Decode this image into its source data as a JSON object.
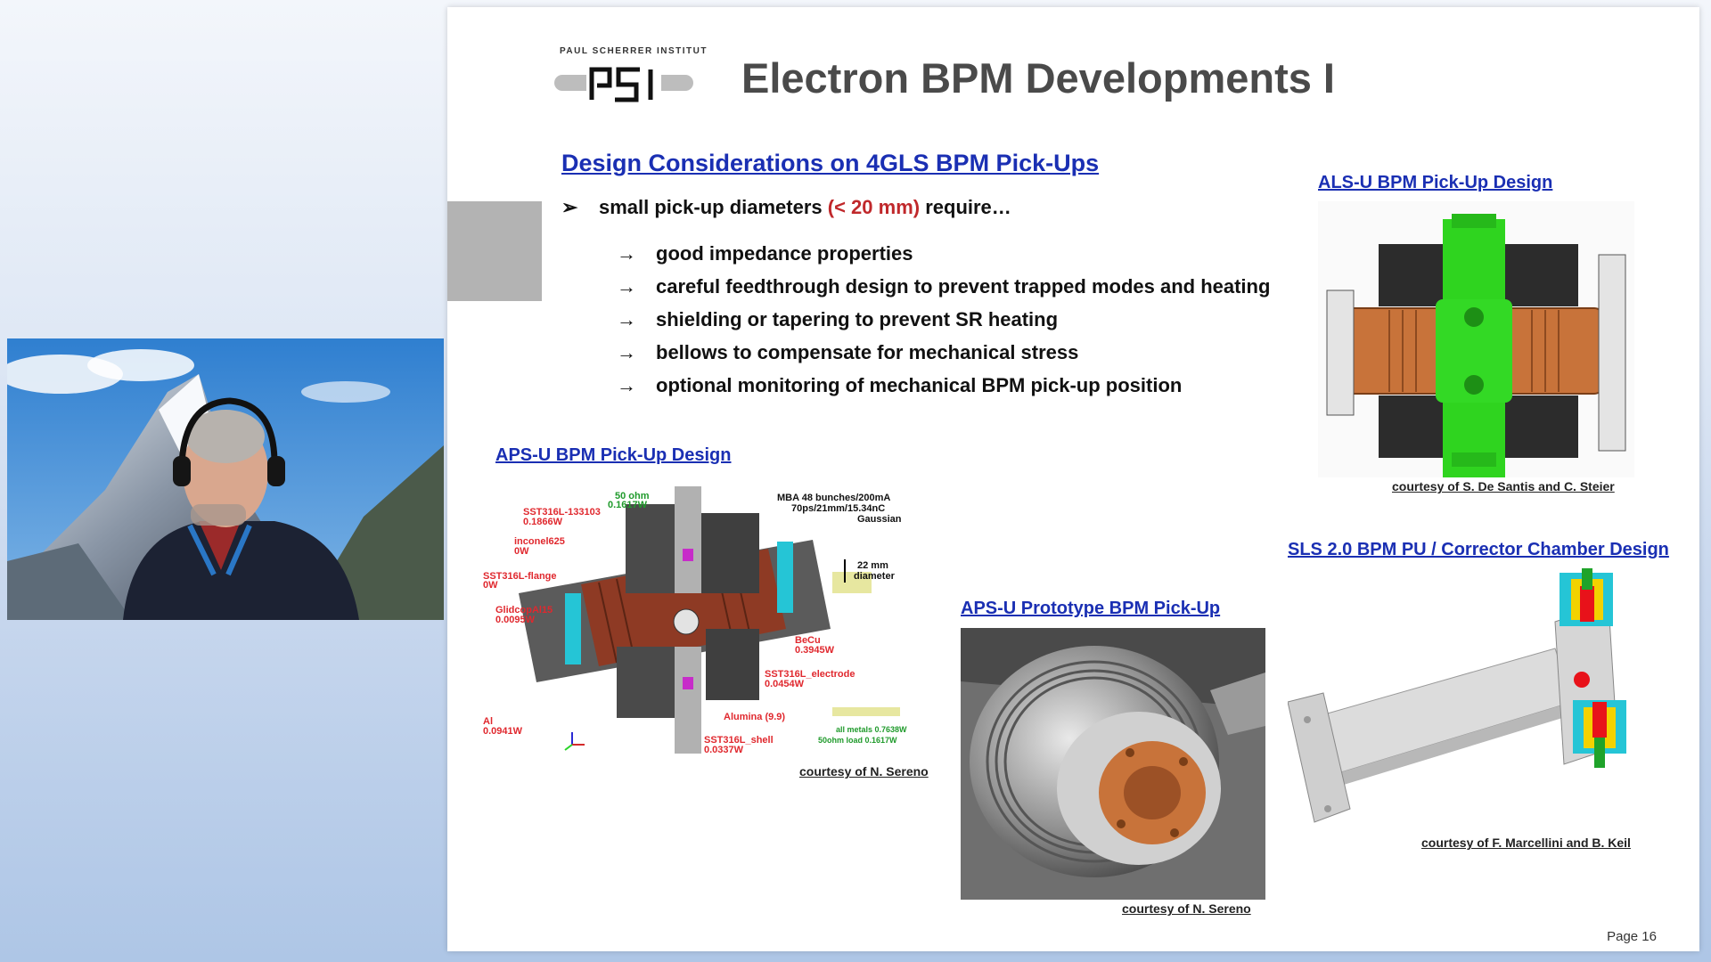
{
  "slide": {
    "logo_caption": "PAUL SCHERRER INSTITUT",
    "logo_text": "PSI",
    "title": "Electron BPM Developments I",
    "heading": "Design Considerations on 4GLS BPM Pick-Ups",
    "bullet": {
      "prefix": "small pick-up diameters ",
      "highlight": "(< 20 mm)",
      "suffix": " require…",
      "marker": "➢"
    },
    "sub_arrow": "→",
    "sub_items": [
      "good impedance properties",
      "careful feedthrough design to prevent trapped modes and heating",
      "shielding or tapering to prevent SR heating",
      "bellows to compensate for mechanical stress",
      "optional monitoring of mechanical BPM pick-up position"
    ],
    "figures": {
      "alsu": {
        "title": "ALS-U BPM Pick-Up Design",
        "credit": "courtesy of S. De Santis and C. Steier"
      },
      "apsu": {
        "title": "APS-U BPM Pick-Up Design",
        "credit": "courtesy of N. Sereno",
        "sim_note": [
          "MBA 48 bunches/200mA",
          "70ps/21mm/15.34nC",
          "Gaussian"
        ],
        "diameter_note": [
          "22 mm",
          "diameter"
        ],
        "labels": [
          {
            "name": "50 ohm",
            "value": "0.1617W",
            "color": "#1f9a2b"
          },
          {
            "name": "SST316L-133103",
            "value": "0.1866W",
            "color": "#e0282e"
          },
          {
            "name": "inconel625",
            "value": "0W",
            "color": "#e0282e"
          },
          {
            "name": "SST316L-flange",
            "value": "0W",
            "color": "#e0282e"
          },
          {
            "name": "GlidcopAl15",
            "value": "0.0095W",
            "color": "#e0282e"
          },
          {
            "name": "Al",
            "value": "0.0941W",
            "color": "#e0282e"
          },
          {
            "name": "BeCu",
            "value": "0.3945W",
            "color": "#e0282e"
          },
          {
            "name": "SST316L_electrode",
            "value": "0.0454W",
            "color": "#e0282e"
          },
          {
            "name": "Alumina (9.9)",
            "value": "",
            "color": "#e0282e"
          },
          {
            "name": "SST316L_shell",
            "value": "0.0337W",
            "color": "#e0282e"
          }
        ],
        "totals": [
          "all metals 0.7638W",
          "50ohm load 0.1617W"
        ]
      },
      "proto": {
        "title": "APS-U Prototype BPM Pick-Up",
        "credit": "courtesy of N. Sereno"
      },
      "sls": {
        "title": "SLS 2.0 BPM PU / Corrector Chamber Design",
        "credit": "courtesy of F. Marcellini and B. Keil"
      }
    },
    "page": "Page 16"
  },
  "colors": {
    "heading_blue": "#1a2fb3",
    "highlight_red": "#c0282b",
    "title_gray": "#4a4a4a",
    "green_part": "#2fd41f",
    "copper": "#c8733a"
  }
}
